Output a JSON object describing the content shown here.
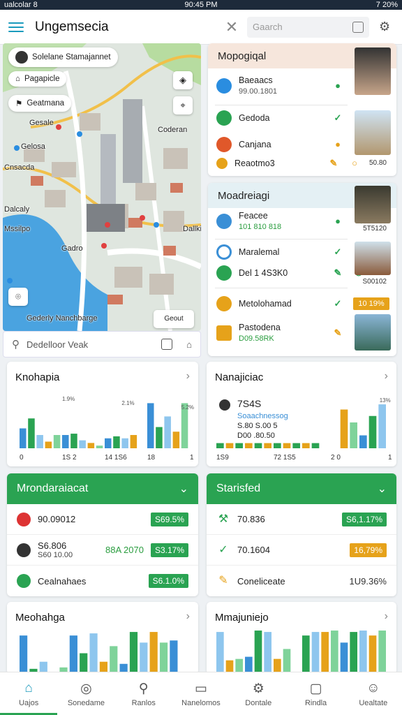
{
  "status": {
    "left": "ualcolar 8",
    "time": "90:45 PM",
    "right": "7 20%"
  },
  "header": {
    "title": "Ungemsecia",
    "search_placeholder": "Gaarch"
  },
  "map": {
    "pills": [
      "Solelane Stamajannet",
      "Pagapicle",
      "Geatmana"
    ],
    "labels": [
      "Gesale",
      "Gelosa",
      "Coderan",
      "Cnsacda",
      "Dalcaly",
      "Mssilpo",
      "Dallkin",
      "Gadro",
      "Gederly Nanchbarge"
    ],
    "btn_label": "Geout",
    "search_text": "Dedelloor Veak"
  },
  "list_top": {
    "title": "Mopogiqal",
    "rows": [
      {
        "title": "Baeaacs",
        "sub": "99.00.1801",
        "sub_color": "gray"
      },
      {
        "title": "Gedoda",
        "sub": "",
        "sub_color": "gray"
      },
      {
        "title": "Canjana",
        "sub": "",
        "sub_color": "gray"
      },
      {
        "title": "Reaotmo3",
        "sub": "",
        "sub_color": "gray"
      }
    ],
    "thumb_captions": [
      "",
      "50.80"
    ]
  },
  "list_bottom": {
    "title": "Moadreiagi",
    "rows": [
      {
        "title": "Feacee",
        "sub": "101 810 818",
        "sub_color": "green"
      },
      {
        "title": "Maralemal",
        "sub": "",
        "sub_color": "gray"
      },
      {
        "title": "Del 1 4S3K0",
        "sub": "",
        "sub_color": "gray"
      },
      {
        "title": "Metolohamad",
        "sub": "",
        "sub_color": "gray"
      },
      {
        "title": "Pastodena",
        "sub": "D09.58RK",
        "sub_color": "green"
      }
    ],
    "thumb_captions": [
      "5T5120",
      "S00102"
    ],
    "badge": "10 19%"
  },
  "chart1": {
    "title": "Knohapia",
    "chart_data": {
      "type": "bar",
      "categories": [
        "0",
        "",
        "",
        "",
        "",
        "",
        "",
        "",
        "",
        "",
        "",
        "",
        "",
        "",
        "",
        "",
        "",
        "",
        "",
        ""
      ],
      "series": [
        {
          "values": [
            30,
            45,
            20,
            10,
            20,
            20,
            22,
            12,
            8,
            4,
            15,
            18,
            15,
            20,
            0,
            68,
            32,
            48,
            25,
            68
          ]
        }
      ],
      "tick_labels": [
        "0",
        "1S 2",
        "14 1S6",
        "18",
        "1"
      ],
      "data_labels": [
        "1.9%",
        "2.1%",
        "5.2%"
      ],
      "ylim": [
        0,
        80
      ]
    }
  },
  "chart2": {
    "title": "Nanajiciac",
    "value": "7S4S",
    "lines": [
      "Soaachnessog",
      "S.80 S.00 5",
      "D00 .80.50"
    ],
    "chart_data": {
      "type": "bar",
      "categories": [
        "",
        "",
        "",
        "",
        "",
        "",
        "",
        "",
        "",
        "",
        "",
        "",
        "",
        "",
        "",
        "",
        "",
        ""
      ],
      "series": [
        {
          "values": [
            8,
            8,
            8,
            8,
            8,
            8,
            8,
            8,
            8,
            8,
            8,
            0,
            0,
            60,
            40,
            20,
            50,
            68
          ]
        }
      ],
      "tick_labels": [
        "1S9",
        "72 1S5",
        "2 0",
        "1"
      ],
      "data_labels": [
        "13%"
      ],
      "ylim": [
        0,
        80
      ]
    }
  },
  "stats1": {
    "title": "Mrondaraiacat",
    "rows": [
      {
        "label": "90.09012",
        "sub": "",
        "mid": "",
        "badge": "S69.5%",
        "badge_color": "#2aa352"
      },
      {
        "label": "S6.806",
        "sub": "S60 10.00",
        "mid": "88A 2070",
        "badge": "S3.17%",
        "badge_color": "#2aa352"
      },
      {
        "label": "Cealnahaes",
        "sub": "",
        "mid": "",
        "badge": "S6.1.0%",
        "badge_color": "#2aa352"
      }
    ]
  },
  "stats2": {
    "title": "Starisfed",
    "rows": [
      {
        "label": "70.836",
        "sub": "",
        "mid": "",
        "badge": "S6,1.17%",
        "badge_color": "#2aa352"
      },
      {
        "label": "70.1604",
        "sub": "",
        "mid": "",
        "badge": "16,79%",
        "badge_color": "#e6a21a"
      },
      {
        "label": "Coneliceate",
        "sub": "",
        "mid": "1U9.36%",
        "badge": "",
        "badge_color": ""
      }
    ]
  },
  "chart3": {
    "title": "Meohahga",
    "chart_data": {
      "type": "bar",
      "categories": [
        "",
        "",
        "",
        "",
        "",
        "",
        "",
        "",
        "",
        "",
        "",
        "",
        "",
        "",
        "",
        "",
        ""
      ],
      "series": [
        {
          "values": [
            55,
            8,
            18,
            0,
            10,
            55,
            30,
            58,
            18,
            40,
            15,
            60,
            45,
            60,
            45,
            48,
            0
          ]
        }
      ],
      "ylim": [
        0,
        65
      ]
    }
  },
  "chart4": {
    "title": "Mmajuniejo",
    "chart_data": {
      "type": "bar",
      "categories": [
        "",
        "",
        "",
        "",
        "",
        "",
        "",
        "",
        "",
        "",
        "",
        "",
        "",
        "",
        "",
        "",
        "",
        ""
      ],
      "series": [
        {
          "values": [
            60,
            20,
            22,
            25,
            62,
            60,
            22,
            36,
            0,
            55,
            60,
            60,
            62,
            45,
            60,
            62,
            55,
            62
          ]
        }
      ],
      "ylim": [
        0,
        65
      ]
    }
  },
  "nav": [
    "Uajos",
    "Sonedame",
    "Ranlos",
    "Nanelomos",
    "Dontale",
    "Rindla",
    "Uealtate"
  ],
  "colors": {
    "green": "#2aa352",
    "blue": "#3a8fd6",
    "lightblue": "#8ec6ee",
    "orange": "#e6a21a",
    "lightgreen": "#7fd39a",
    "teal": "#1f9bbd"
  }
}
